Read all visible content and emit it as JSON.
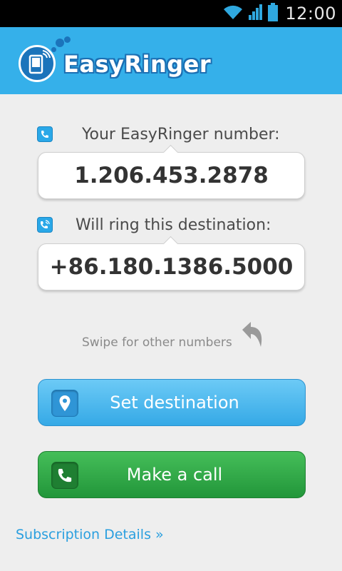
{
  "status_bar": {
    "time": "12:00",
    "icons": [
      "wifi-icon",
      "signal-icon",
      "battery-icon"
    ]
  },
  "header": {
    "app_title": "EasyRinger",
    "logo_icon": "phone-signal-logo-icon"
  },
  "number_section": {
    "label": "Your EasyRinger number:",
    "value": "1.206.453.2878",
    "icon": "phone-icon"
  },
  "destination_section": {
    "label": "Will ring this destination:",
    "value": "+86.180.1386.5000",
    "icon": "phone-ringing-icon"
  },
  "swipe_hint": {
    "text": "Swipe for other numbers",
    "icon": "swipe-back-arrow-icon"
  },
  "buttons": {
    "set_destination": {
      "label": "Set destination",
      "icon": "location-pin-icon"
    },
    "make_call": {
      "label": "Make a call",
      "icon": "phone-icon"
    }
  },
  "footer": {
    "subscription_link": "Subscription Details »"
  },
  "colors": {
    "header_blue": "#35b0ea",
    "logo_blue": "#1b74bb",
    "button_blue": "#35a9e6",
    "button_green": "#22963a",
    "link_blue": "#2a9fdf"
  }
}
